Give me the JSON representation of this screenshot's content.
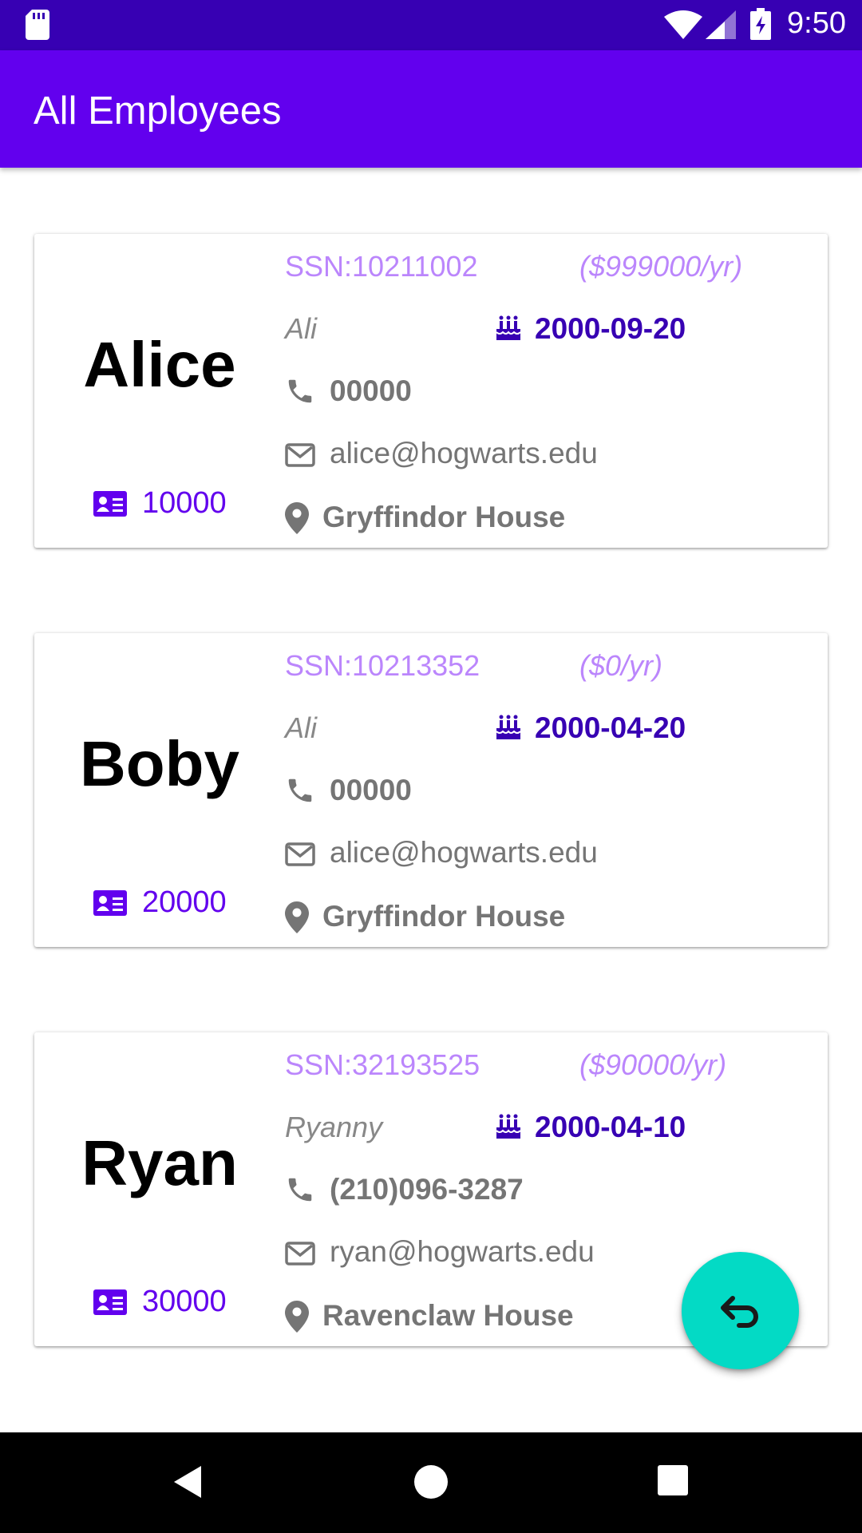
{
  "status_bar": {
    "time": "9:50"
  },
  "app_bar": {
    "title": "All Employees"
  },
  "employees": [
    {
      "name": "Alice",
      "id": "10000",
      "ssn": "SSN:10211002",
      "salary": "($999000/yr)",
      "nickname": "Ali",
      "birthday": "2000-09-20",
      "phone": "00000",
      "email": "alice@hogwarts.edu",
      "house": "Gryffindor House"
    },
    {
      "name": "Boby",
      "id": "20000",
      "ssn": "SSN:10213352",
      "salary": "($0/yr)",
      "nickname": "Ali",
      "birthday": "2000-04-20",
      "phone": "00000",
      "email": "alice@hogwarts.edu",
      "house": "Gryffindor House"
    },
    {
      "name": "Ryan",
      "id": "30000",
      "ssn": "SSN:32193525",
      "salary": "($90000/yr)",
      "nickname": "Ryanny",
      "birthday": "2000-04-10",
      "phone": "(210)096-3287",
      "email": "ryan@hogwarts.edu",
      "house": "Ravenclaw House"
    }
  ],
  "colors": {
    "status_bar": "#3700b3",
    "app_bar": "#6200ee",
    "accent": "#6200ee",
    "ssn_text": "#bb86fc",
    "birthday_text": "#3700b3",
    "fab": "#03dac5"
  },
  "icons": {
    "id": "id-card-icon",
    "birthday": "birthday-cake-icon",
    "phone": "phone-icon",
    "email": "envelope-icon",
    "address": "map-pin-icon",
    "fab": "undo-icon"
  }
}
